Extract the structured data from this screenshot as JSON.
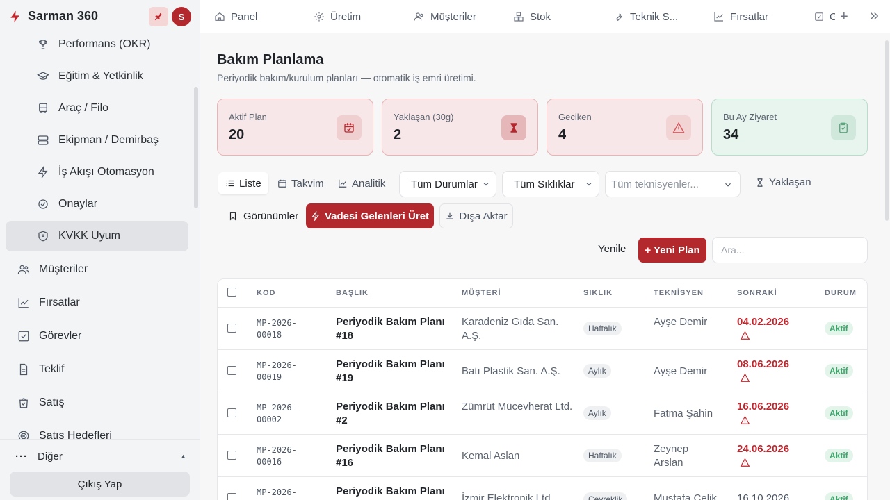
{
  "brand": {
    "name": "Sarman 360",
    "avatar_initial": "S"
  },
  "sidebar": {
    "sub_items": [
      {
        "label": "Performans (OKR)",
        "icon": "trophy-icon"
      },
      {
        "label": "Eğitim & Yetkinlik",
        "icon": "graduation-cap-icon"
      },
      {
        "label": "Araç / Filo",
        "icon": "bus-icon"
      },
      {
        "label": "Ekipman / Demirbaş",
        "icon": "server-icon"
      },
      {
        "label": "İş Akışı Otomasyon",
        "icon": "zap-icon"
      },
      {
        "label": "Onaylar",
        "icon": "check-circle-icon"
      },
      {
        "label": "KVKK Uyum",
        "icon": "shield-icon",
        "active": true
      }
    ],
    "items": [
      {
        "label": "Müşteriler",
        "icon": "users-icon"
      },
      {
        "label": "Fırsatlar",
        "icon": "trending-up-icon"
      },
      {
        "label": "Görevler",
        "icon": "check-square-icon"
      },
      {
        "label": "Teklif",
        "icon": "file-text-icon"
      },
      {
        "label": "Satış",
        "icon": "shopping-bag-icon"
      },
      {
        "label": "Satış Hedefleri",
        "icon": "target-icon"
      }
    ],
    "other_label": "Diğer",
    "logout_label": "Çıkış Yap"
  },
  "topnav": {
    "tabs": [
      {
        "label": "Panel",
        "icon": "home-icon"
      },
      {
        "label": "Üretim",
        "icon": "gear-icon"
      },
      {
        "label": "Müşteriler",
        "icon": "users-icon"
      },
      {
        "label": "Stok",
        "icon": "boxes-icon"
      },
      {
        "label": "Teknik S...",
        "icon": "wrench-icon"
      },
      {
        "label": "Fırsatlar",
        "icon": "trending-up-icon"
      },
      {
        "label": "G",
        "icon": "check-square-icon"
      }
    ]
  },
  "page": {
    "title": "Bakım Planlama",
    "subtitle": "Periyodik bakım/kurulum planları — otomatik iş emri üretimi."
  },
  "kpis": [
    {
      "label": "Aktif Plan",
      "value": "20",
      "icon": "calendar-check-icon"
    },
    {
      "label": "Yaklaşan (30g)",
      "value": "2",
      "icon": "hourglass-icon"
    },
    {
      "label": "Geciken",
      "value": "4",
      "icon": "alert-triangle-icon"
    },
    {
      "label": "Bu Ay Ziyaret",
      "value": "34",
      "icon": "clipboard-check-icon"
    }
  ],
  "toolbar": {
    "view_tabs": [
      "Liste",
      "Takvim",
      "Analitik"
    ],
    "status_filter": "Tüm Durumlar",
    "frequency_filter": "Tüm Sıklıklar",
    "technician_placeholder": "Tüm teknisyenler...",
    "approaching_label": "Yaklaşan",
    "views_label": "Görünümler",
    "generate_label": "Vadesi Gelenleri Üret",
    "export_label": "Dışa Aktar",
    "refresh_label": "Yenile",
    "new_label": "+ Yeni Plan",
    "search_placeholder": "Ara..."
  },
  "table": {
    "headers": [
      "KOD",
      "BAŞLIK",
      "MÜŞTERİ",
      "SIKLIK",
      "TEKNİSYEN",
      "SONRAKİ",
      "DURUM"
    ],
    "rows": [
      {
        "code1": "MP-2026-",
        "code2": "00018",
        "title": "Periyodik Bakım Planı #18",
        "customer": "Karadeniz Gıda San. A.Ş.",
        "frequency": "Haftalık",
        "technician": "Ayşe Demir",
        "next": "04.02.2026",
        "overdue": true,
        "status": "Aktif"
      },
      {
        "code1": "MP-2026-",
        "code2": "00019",
        "title": "Periyodik Bakım Planı #19",
        "customer": "Batı Plastik San. A.Ş.",
        "frequency": "Aylık",
        "technician": "Ayşe Demir",
        "next": "08.06.2026",
        "overdue": true,
        "status": "Aktif"
      },
      {
        "code1": "MP-2026-",
        "code2": "00002",
        "title": "Periyodik Bakım Planı #2",
        "customer": "Zümrüt Mücevherat Ltd.",
        "frequency": "Aylık",
        "technician": "Fatma Şahin",
        "next": "16.06.2026",
        "overdue": true,
        "status": "Aktif"
      },
      {
        "code1": "MP-2026-",
        "code2": "00016",
        "title": "Periyodik Bakım Planı #16",
        "customer": "Kemal Aslan",
        "frequency": "Haftalık",
        "technician": "Zeynep Arslan",
        "next": "24.06.2026",
        "overdue": true,
        "status": "Aktif"
      },
      {
        "code1": "MP-2026-",
        "code2": "",
        "title": "Periyodik Bakım Planı",
        "customer": "İzmir Elektronik Ltd.",
        "frequency": "Çeyreklik",
        "technician": "Mustafa Çelik",
        "next": "16.10.2026",
        "overdue": false,
        "status": "Aktif"
      }
    ]
  },
  "colors": {
    "accent": "#b3282d",
    "danger": "#c0262d",
    "success": "#3da66a"
  }
}
